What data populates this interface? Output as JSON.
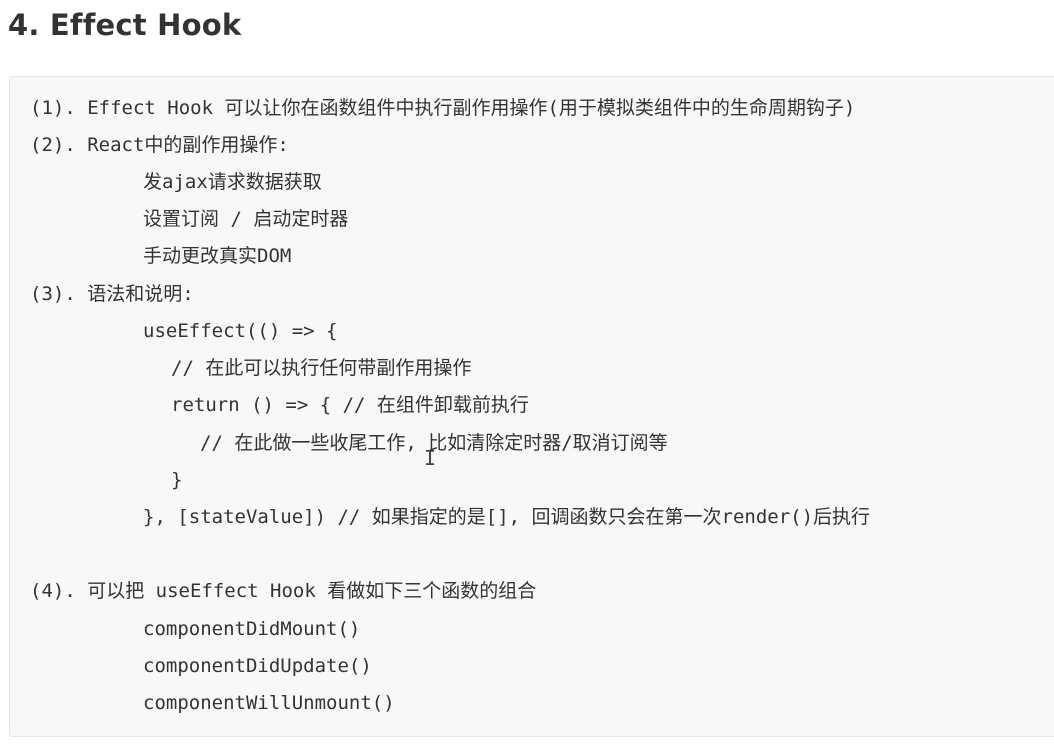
{
  "heading": "4. Effect Hook",
  "lines": [
    "(1). Effect Hook 可以让你在函数组件中执行副作用操作(用于模拟类组件中的生命周期钩子)",
    "(2). React中的副作用操作:",
    "发ajax请求数据获取",
    "设置订阅 / 启动定时器",
    "手动更改真实DOM",
    "(3). 语法和说明:",
    "useEffect(() => {",
    "// 在此可以执行任何带副作用操作",
    "return () => { // 在组件卸载前执行",
    "// 在此做一些收尾工作, 比如清除定时器/取消订阅等",
    "}",
    "}, [stateValue]) // 如果指定的是[], 回调函数只会在第一次render()后执行",
    "(4). 可以把 useEffect Hook 看做如下三个函数的组合",
    "componentDidMount()",
    "componentDidUpdate()",
    "componentWillUnmount()"
  ],
  "cursor_glyph": "I"
}
